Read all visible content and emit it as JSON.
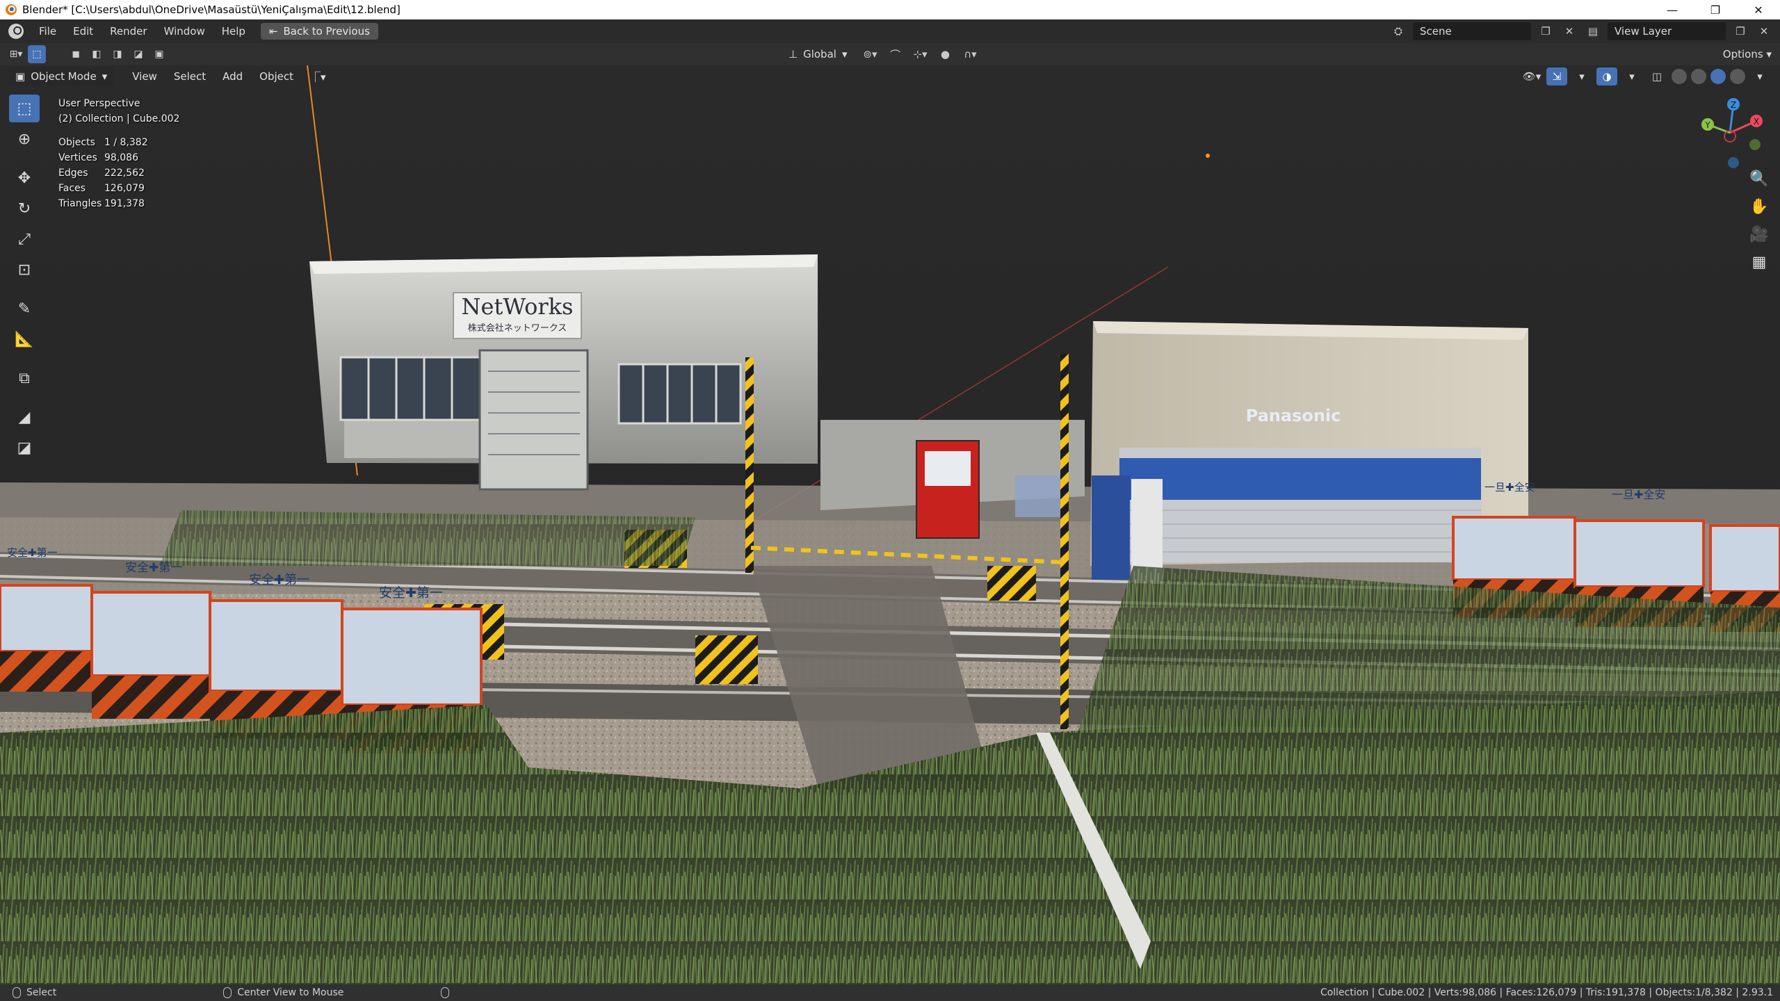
{
  "window": {
    "title": "Blender* [C:\\Users\\abdul\\OneDrive\\Masaüstü\\YeniÇalışma\\Edit\\12.blend]",
    "minimize": "—",
    "maximize": "❐",
    "close": "✕"
  },
  "menubar": {
    "items": [
      "File",
      "Edit",
      "Render",
      "Window",
      "Help"
    ],
    "back_button": "Back to Previous",
    "scene": "Scene",
    "view_layer": "View Layer"
  },
  "toolbar": {
    "orientation": "Global",
    "options": "Options"
  },
  "viewport_header": {
    "mode": "Object Mode",
    "menus": [
      "View",
      "Select",
      "Add",
      "Object"
    ]
  },
  "overlay": {
    "view_name": "User Perspective",
    "collection": "(2) Collection | Cube.002",
    "stats": [
      {
        "label": "Objects",
        "value": "1 / 8,382"
      },
      {
        "label": "Vertices",
        "value": "98,086"
      },
      {
        "label": "Edges",
        "value": "222,562"
      },
      {
        "label": "Faces",
        "value": "126,079"
      },
      {
        "label": "Triangles",
        "value": "191,378"
      }
    ]
  },
  "scene_text": {
    "sign_networks": "NetWorks",
    "sign_networks_sub": "株式会社ネットワークス",
    "panasonic": "Panasonic",
    "barrier_text_left": "安全✚第一",
    "barrier_text_right": "一旦✚全安"
  },
  "gizmo": {
    "x": "X",
    "y": "Y",
    "z": "Z"
  },
  "statusbar": {
    "select": "Select",
    "center_view": "Center View to Mouse",
    "info": "Collection | Cube.002 | Verts:98,086 | Faces:126,079 | Tris:191,378 | Objects:1/8,382 | 2.93.1"
  },
  "colors": {
    "accent": "#4772b3",
    "axis_x": "#e84a5f",
    "axis_y": "#8bc34a",
    "axis_z": "#3c8dd9",
    "light_origin": "#ff9a1f"
  }
}
